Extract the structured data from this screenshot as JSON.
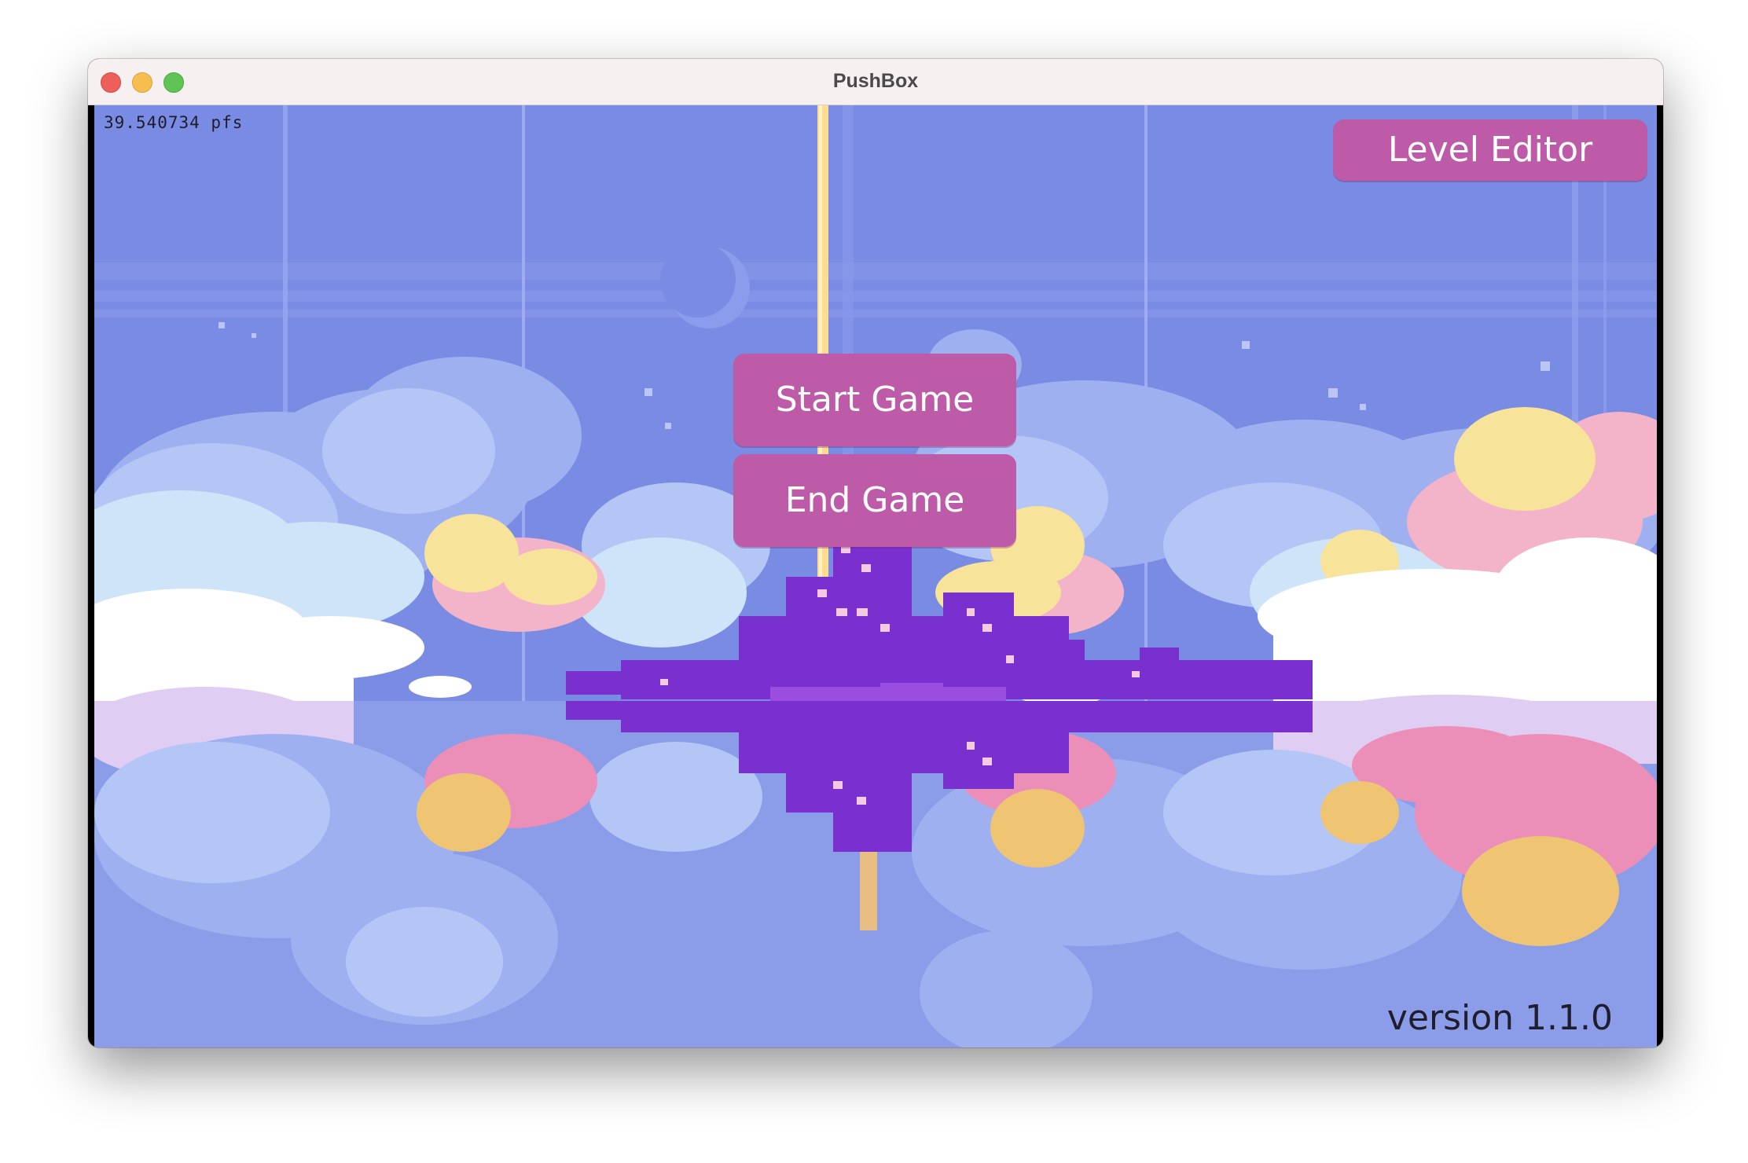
{
  "window": {
    "title": "PushBox",
    "controls": [
      "close",
      "minimize",
      "maximize"
    ]
  },
  "game": {
    "fps_counter": "39.540734 pfs",
    "version_label": "version 1.1.0",
    "background": "pixel-art sky with clouds reflected over water and a purple floating city",
    "buttons": {
      "level_editor": "Level Editor",
      "start_game": "Start Game",
      "end_game": "End Game"
    },
    "colors": {
      "button": "#bd5ba8",
      "button_text": "#ffffff",
      "sky": "#7a8be3",
      "city": "#7a2fcf"
    }
  }
}
